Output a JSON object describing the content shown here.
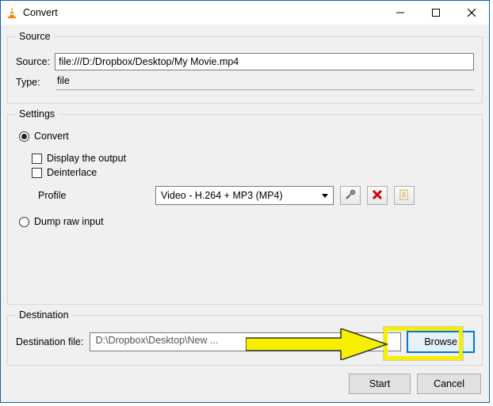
{
  "window": {
    "title": "Convert"
  },
  "groups": {
    "source": "Source",
    "settings": "Settings",
    "destination": "Destination"
  },
  "source": {
    "label": "Source:",
    "value": "file:///D:/Dropbox/Desktop/My Movie.mp4",
    "type_label": "Type:",
    "type_value": "file"
  },
  "settings": {
    "convert_label": "Convert",
    "display_output_label": "Display the output",
    "deinterlace_label": "Deinterlace",
    "profile_label": "Profile",
    "profile_value": "Video - H.264 + MP3 (MP4)",
    "dump_label": "Dump raw input"
  },
  "destination": {
    "label": "Destination file:",
    "value": "D:\\Dropbox\\Desktop\\New ...",
    "browse_label": "Browse"
  },
  "footer": {
    "start_label": "Start",
    "cancel_label": "Cancel"
  }
}
